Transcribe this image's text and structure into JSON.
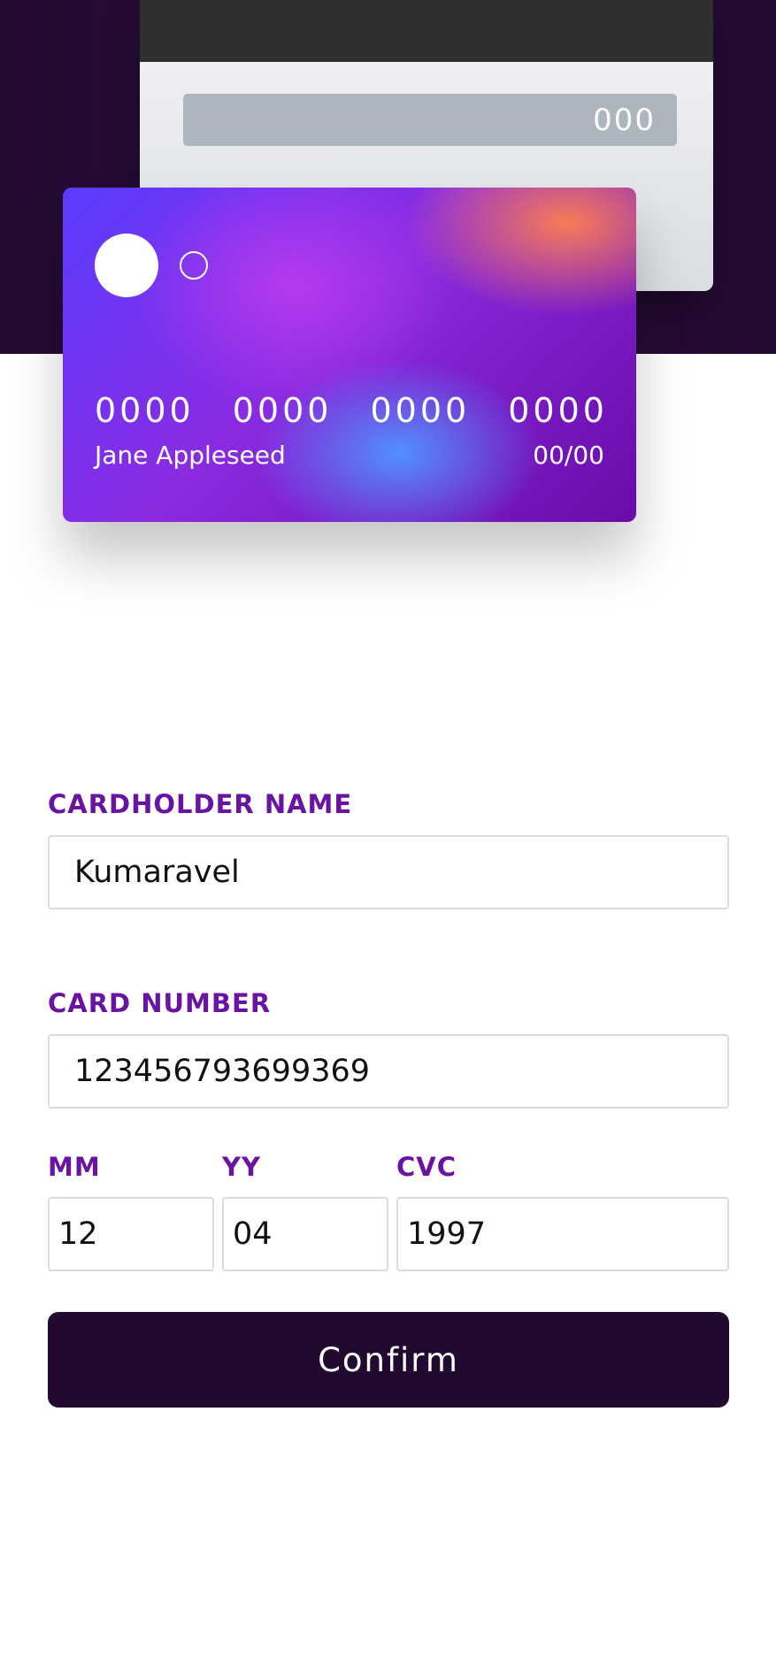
{
  "card_back": {
    "cvc": "000"
  },
  "card_front": {
    "number_groups": [
      "0000",
      "0000",
      "0000",
      "0000"
    ],
    "holder_name": "Jane Appleseed",
    "expiry": "00/00"
  },
  "form": {
    "cardholder_label": "CARDHOLDER NAME",
    "cardholder_value": "Kumaravel",
    "card_number_label": "CARD NUMBER",
    "card_number_value": "123456793699369",
    "mm_label": "MM",
    "mm_value": "12",
    "yy_label": "YY",
    "yy_value": "04",
    "cvc_label": "CVC",
    "cvc_value": "1997",
    "confirm_label": "Confirm"
  },
  "colors": {
    "hero_bg": "#230a31",
    "label": "#6a12a1",
    "button_bg": "#220930",
    "input_border": "#dcdcdc"
  }
}
